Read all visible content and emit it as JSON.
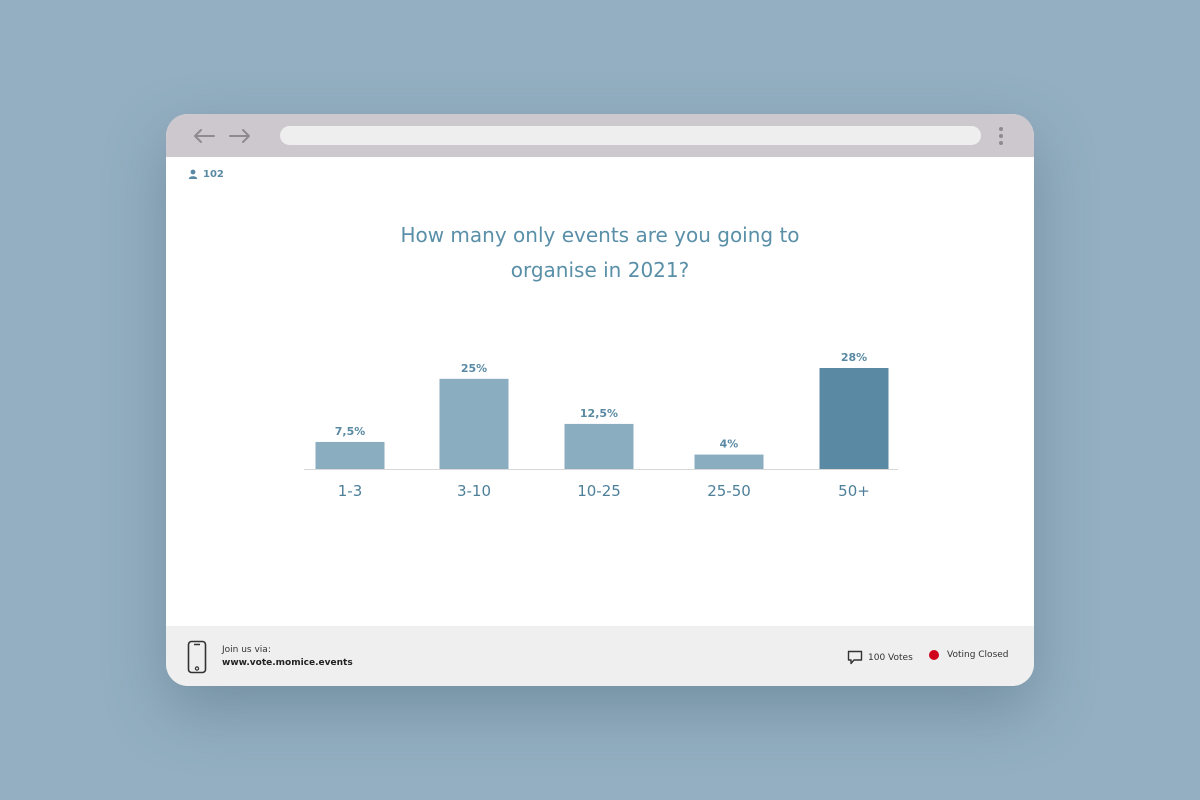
{
  "participants": {
    "count": "102"
  },
  "question": {
    "line1": "How many only events are you going to",
    "line2": "organise in 2021?"
  },
  "chart_data": {
    "type": "bar",
    "categories": [
      "1-3",
      "3-10",
      "10-25",
      "25-50",
      "50+"
    ],
    "values": [
      7.5,
      25,
      12.5,
      4,
      28
    ],
    "value_labels": [
      "7,5%",
      "25%",
      "12,5%",
      "4%",
      "28%"
    ],
    "highlight_index": 4,
    "colors": {
      "bar": "#8badc0",
      "highlight": "#5a8aa3",
      "axis": "#d8d8d8"
    },
    "ylim": [
      0,
      28
    ],
    "grid": false
  },
  "footer": {
    "join_label": "Join us via:",
    "join_url": "www.vote.momice.events",
    "votes_label": "100 Votes",
    "status_label": "Voting Closed",
    "status_color": "#d0021b"
  },
  "icons": {
    "back": "arrow-left-icon",
    "forward": "arrow-right-icon",
    "menu": "kebab-menu-icon",
    "user": "user-icon",
    "phone": "phone-icon",
    "comment": "comment-icon"
  }
}
